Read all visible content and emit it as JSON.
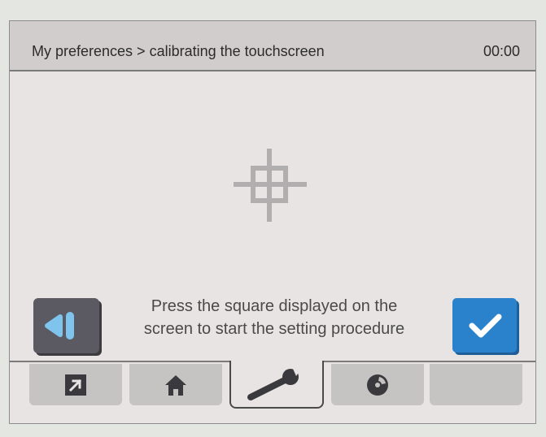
{
  "header": {
    "title": "My preferences > calibrating the touchscreen",
    "clock": "00:00"
  },
  "main": {
    "message_line1": "Press the square displayed on the",
    "message_line2": "screen to start the setting procedure"
  },
  "tabs": [
    {
      "icon": "shortcut-arrow-icon",
      "active": false
    },
    {
      "icon": "home-icon",
      "active": false
    },
    {
      "icon": "wrench-icon",
      "active": true
    },
    {
      "icon": "disc-icon",
      "active": false
    },
    {
      "icon": "",
      "active": false
    }
  ],
  "colors": {
    "back_button": "#5b5a62",
    "confirm_button": "#2b82cc",
    "accent_light_blue": "#7fc4ec"
  }
}
